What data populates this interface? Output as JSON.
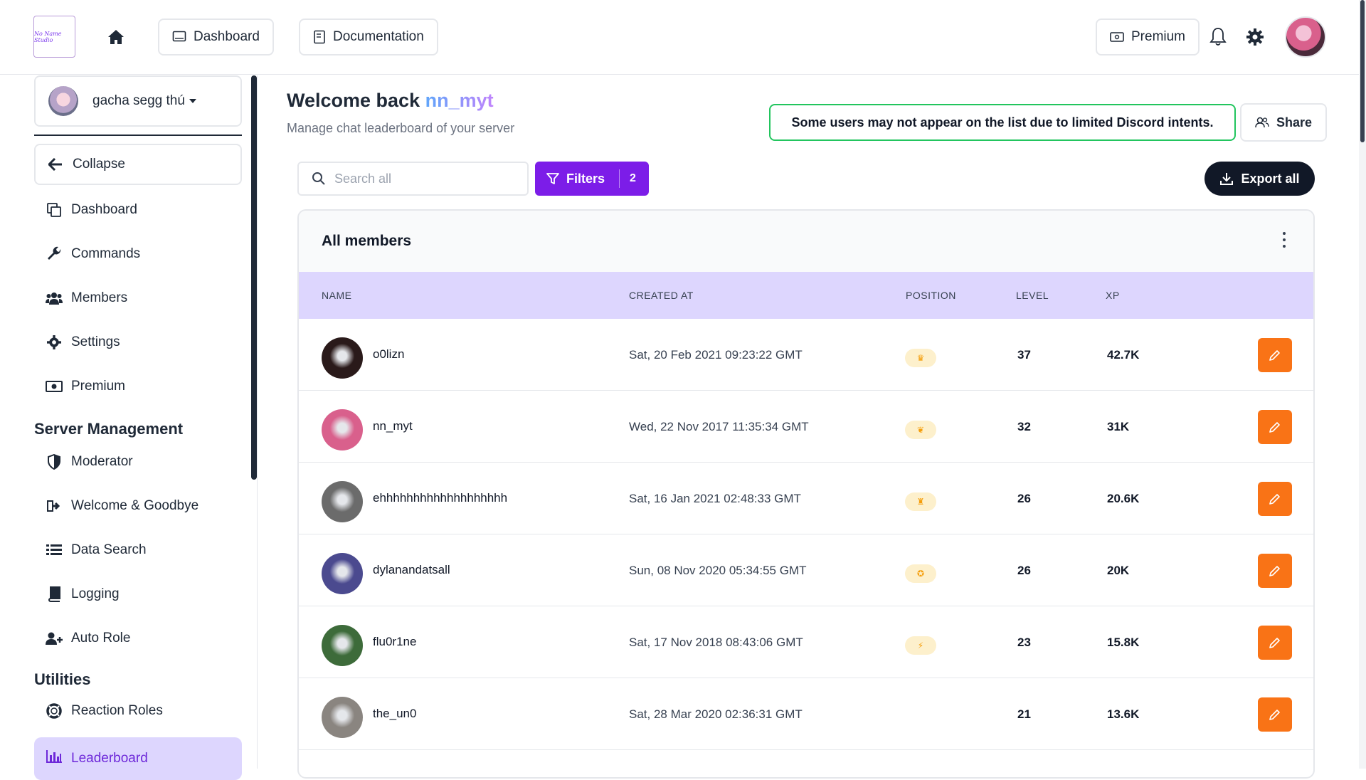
{
  "topbar": {
    "logo_text": "No Name Studio",
    "dashboard_label": "Dashboard",
    "documentation_label": "Documentation",
    "premium_label": "Premium"
  },
  "sidebar": {
    "server_name": "gacha segg thú",
    "collapse_label": "Collapse",
    "items": [
      {
        "label": "Dashboard",
        "icon": "copy-icon"
      },
      {
        "label": "Commands",
        "icon": "wrench-icon"
      },
      {
        "label": "Members",
        "icon": "users-icon"
      },
      {
        "label": "Settings",
        "icon": "gear-icon"
      },
      {
        "label": "Premium",
        "icon": "money-icon"
      }
    ],
    "server_management_title": "Server Management",
    "server_management": [
      {
        "label": "Moderator",
        "icon": "shield-icon"
      },
      {
        "label": "Welcome & Goodbye",
        "icon": "sign-in-icon"
      },
      {
        "label": "Data Search",
        "icon": "list-icon"
      },
      {
        "label": "Logging",
        "icon": "book-icon"
      },
      {
        "label": "Auto Role",
        "icon": "user-plus-icon"
      }
    ],
    "utilities_title": "Utilities",
    "utilities": [
      {
        "label": "Reaction Roles",
        "icon": "lifebuoy-icon"
      }
    ],
    "active_label": "Leaderboard"
  },
  "main": {
    "welcome_prefix": "Welcome back ",
    "welcome_user": "nn_myt",
    "subtitle": "Manage chat leaderboard of your server",
    "notice": "Some users may not appear on the list due to limited Discord intents.",
    "share_label": "Share",
    "search_placeholder": "Search all",
    "filters_label": "Filters",
    "filters_count": "2",
    "export_label": "Export all",
    "table_title": "All members",
    "columns": {
      "name": "NAME",
      "created_at": "CREATED AT",
      "position": "POSITION",
      "level": "LEVEL",
      "xp": "XP"
    },
    "rows": [
      {
        "name": "o0lizn",
        "created": "Sat, 20 Feb 2021 09:23:22 GMT",
        "position_icon": "crown-icon",
        "level": "37",
        "xp": "42.7K",
        "avatar_color": "#2a1a1a"
      },
      {
        "name": "nn_myt",
        "created": "Wed, 22 Nov 2017 11:35:34 GMT",
        "position_icon": "laurel-icon",
        "level": "32",
        "xp": "31K",
        "avatar_color": "#d9608c"
      },
      {
        "name": "ehhhhhhhhhhhhhhhhhhh",
        "created": "Sat, 16 Jan 2021 02:48:33 GMT",
        "position_icon": "trophy-icon",
        "level": "26",
        "xp": "20.6K",
        "avatar_color": "#6b6b6b"
      },
      {
        "name": "dylanandatsall",
        "created": "Sun, 08 Nov 2020 05:34:55 GMT",
        "position_icon": "medal-icon",
        "level": "26",
        "xp": "20K",
        "avatar_color": "#4b4a8f"
      },
      {
        "name": "flu0r1ne",
        "created": "Sat, 17 Nov 2018 08:43:06 GMT",
        "position_icon": "bolt-icon",
        "level": "23",
        "xp": "15.8K",
        "avatar_color": "#3d6b3a"
      },
      {
        "name": "the_un0",
        "created": "Sat, 28 Mar 2020 02:36:31 GMT",
        "position_icon": "",
        "level": "21",
        "xp": "13.6K",
        "avatar_color": "#8a8580"
      }
    ]
  }
}
